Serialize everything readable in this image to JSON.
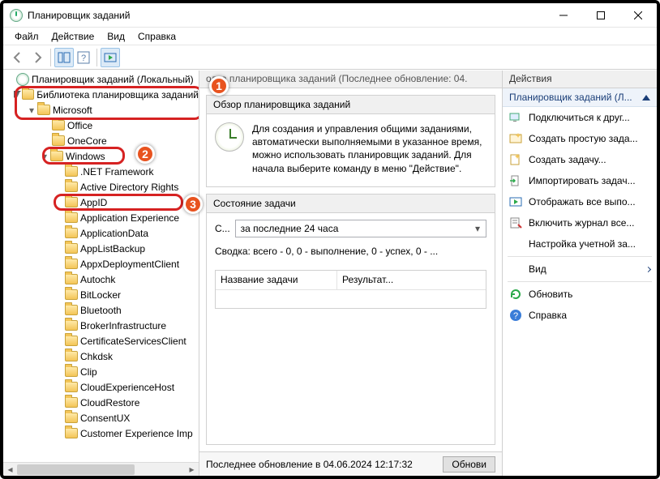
{
  "title": "Планировщик заданий",
  "menu": {
    "file": "Файл",
    "action": "Действие",
    "view": "Вид",
    "help": "Справка"
  },
  "tree": {
    "root": "Планировщик заданий (Локальный)",
    "library": "Библиотека планировщика заданий",
    "microsoft": "Microsoft",
    "office": "Office",
    "onecore": "OneCore",
    "windows": "Windows",
    "children": [
      ".NET Framework",
      "Active Directory Rights",
      "AppID",
      "Application Experience",
      "ApplicationData",
      "AppListBackup",
      "AppxDeploymentClient",
      "Autochk",
      "BitLocker",
      "Bluetooth",
      "BrokerInfrastructure",
      "CertificateServicesClient",
      "Chkdsk",
      "Clip",
      "CloudExperienceHost",
      "CloudRestore",
      "ConsentUX",
      "Customer Experience Imp"
    ]
  },
  "middle": {
    "header": "одка планировщика заданий (Последнее обновление: 04.",
    "overview_title": "Обзор планировщика заданий",
    "overview_text": "Для создания и управления общими заданиями, автоматически выполняемыми в указанное время, можно использовать планировщик заданий. Для начала выберите команду в меню \"Действие\".",
    "status_title": "Состояние задачи",
    "status_label": "С...",
    "status_combo": "за последние 24 часа",
    "summary": "Сводка: всего - 0, 0 - выполнение, 0 - успех, 0 - ...",
    "th1": "Название задачи",
    "th2": "Результат...",
    "footer_text": "Последнее обновление в 04.06.2024 12:17:32",
    "refresh_btn": "Обнови"
  },
  "actions": {
    "header": "Действия",
    "sub": "Планировщик заданий (Л...",
    "items": {
      "connect": "Подключиться к друг...",
      "create_simple": "Создать простую зада...",
      "create_task": "Создать задачу...",
      "import": "Импортировать задач...",
      "show_running": "Отображать все выпо...",
      "enable_journal": "Включить журнал все...",
      "account_cfg": "Настройка учетной за...",
      "view": "Вид",
      "refresh": "Обновить",
      "help": "Справка"
    }
  }
}
